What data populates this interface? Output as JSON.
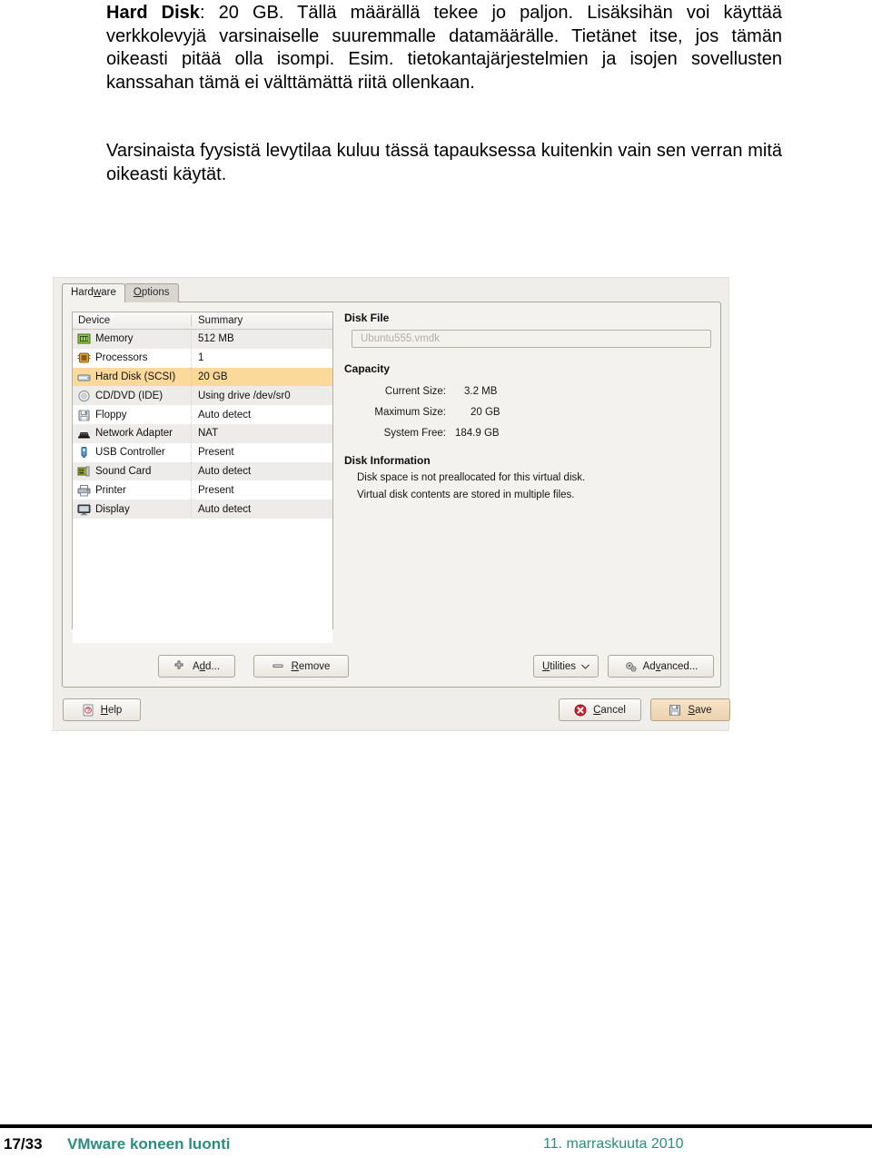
{
  "slide": {
    "paragraph1_html": "<b>Hard Disk</b>: 20 GB. Tällä määrällä tekee jo paljon. Lisäksihän voi käyttää verkkolevyjä varsinaiselle suuremmalle datamäärälle. Tietänet itse, jos tämän oikeasti pitää olla isompi. Esim. tietokantajärjestelmien ja isojen sovellusten kanssahan tämä ei välttämättä riitä ollenkaan.",
    "p1_line1_bold": "Hard Disk",
    "p1_line1_rest": ": 20 GB. Tällä määrällä tekee jo paljon. Lisäksihän voi",
    "p1_line2": "käyttää verkkolevyjä varsinaiselle suuremmalle datamäärälle.",
    "p1_line3": "Tietänet itse, jos tämän oikeasti pitää olla isompi. Esim.",
    "p1_line4": "tietokantajärjestelmien ja isojen sovellusten kanssahan tämä ei",
    "p1_line5": "välttämättä riitä ollenkaan.",
    "p2_line1": "Varsinaista fyysistä levytilaa kuluu tässä tapauksessa kuitenkin",
    "p2_line2": "vain sen verran mitä oikeasti käytät."
  },
  "vm": {
    "tabs": [
      {
        "label_pre": "Hard",
        "label_accel": "w",
        "label_post": "are",
        "active": true
      },
      {
        "label_pre": "",
        "label_accel": "O",
        "label_post": "ptions",
        "active": false
      }
    ],
    "device_table": {
      "headers": [
        "Device",
        "Summary"
      ],
      "rows": [
        {
          "icon": "memory-icon",
          "device": "Memory",
          "summary": "512 MB",
          "selected": false
        },
        {
          "icon": "processor-icon",
          "device": "Processors",
          "summary": "1",
          "selected": false
        },
        {
          "icon": "harddisk-icon",
          "device": "Hard Disk (SCSI)",
          "summary": "20 GB",
          "selected": true
        },
        {
          "icon": "cddvd-icon",
          "device": "CD/DVD (IDE)",
          "summary": "Using drive /dev/sr0",
          "selected": false
        },
        {
          "icon": "floppy-icon",
          "device": "Floppy",
          "summary": "Auto detect",
          "selected": false
        },
        {
          "icon": "network-icon",
          "device": "Network Adapter",
          "summary": "NAT",
          "selected": false
        },
        {
          "icon": "usb-icon",
          "device": "USB Controller",
          "summary": "Present",
          "selected": false
        },
        {
          "icon": "soundcard-icon",
          "device": "Sound Card",
          "summary": "Auto detect",
          "selected": false
        },
        {
          "icon": "printer-icon",
          "device": "Printer",
          "summary": "Present",
          "selected": false
        },
        {
          "icon": "display-icon",
          "device": "Display",
          "summary": "Auto detect",
          "selected": false
        }
      ]
    },
    "disk_file": {
      "title": "Disk File",
      "value": "Ubuntu555.vmdk"
    },
    "capacity": {
      "title": "Capacity",
      "rows": [
        {
          "label": "Current Size:",
          "value": "3.2 MB"
        },
        {
          "label": "Maximum Size:",
          "value": "20 GB"
        },
        {
          "label": "System Free:",
          "value": "184.9 GB"
        }
      ]
    },
    "disk_information": {
      "title": "Disk Information",
      "lines": [
        "Disk space is not preallocated for this virtual disk.",
        "Virtual disk contents are stored in multiple files."
      ]
    },
    "buttons": {
      "add": {
        "pre": "A",
        "accel": "d",
        "post": "d..."
      },
      "remove": {
        "pre": "",
        "accel": "R",
        "post": "emove"
      },
      "utilities": {
        "pre": "",
        "accel": "U",
        "post": "tilities",
        "caret": "⌄"
      },
      "advanced": {
        "pre": "Ad",
        "accel": "v",
        "post": "anced..."
      },
      "help": {
        "pre": "",
        "accel": "H",
        "post": "elp"
      },
      "cancel": {
        "pre": "",
        "accel": "C",
        "post": "ancel"
      },
      "save": {
        "pre": "",
        "accel": "S",
        "post": "ave"
      }
    }
  },
  "footer": {
    "page_number": "17/33",
    "title": "VMware koneen luonti",
    "date": "11. marraskuuta 2010",
    "accent_color": "#2e8b7f"
  }
}
